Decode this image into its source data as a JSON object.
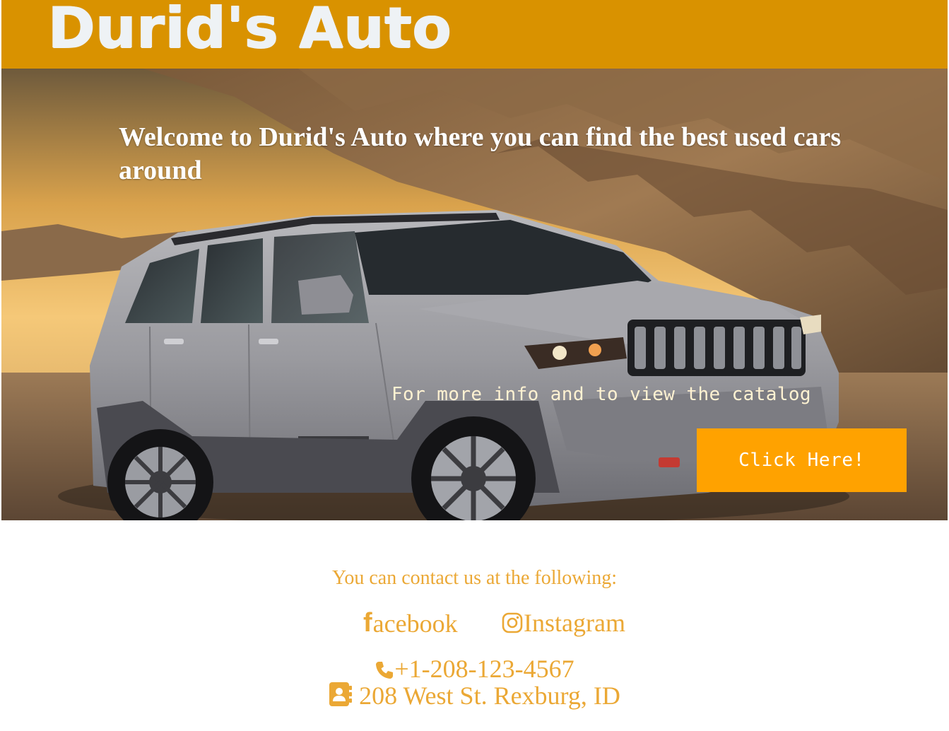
{
  "header": {
    "brand": "Durid's Auto"
  },
  "hero": {
    "welcome": "Welcome to Durid's Auto where you can find the best used cars around",
    "more_info": "For more info and to view the catalog",
    "cta_label": "Click Here!"
  },
  "contact": {
    "heading": "You can contact us at the following:",
    "facebook_label": "acebook",
    "instagram_label": "Instagram",
    "phone": "+1-208-123-4567",
    "address": "208 West St. Rexburg, ID"
  },
  "colors": {
    "header_bg": "#d99200",
    "brand_text": "#eef2f5",
    "cta_bg": "#ffa200",
    "contact_text": "#eba835"
  },
  "icons": [
    "facebook-icon",
    "instagram-icon",
    "phone-icon",
    "address-book-icon"
  ]
}
